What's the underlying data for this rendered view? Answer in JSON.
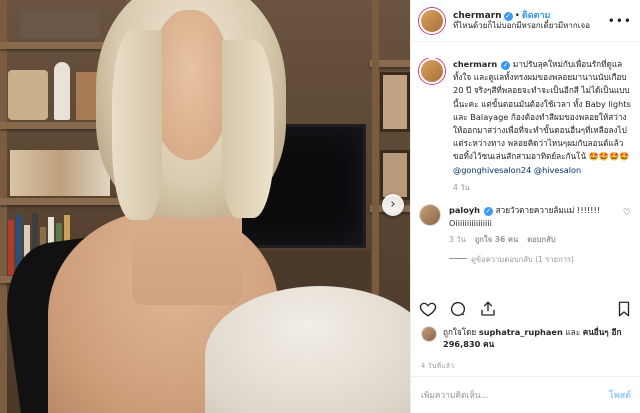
{
  "post": {
    "username": "chermarn",
    "follow_label": "ติดตาม",
    "header_subtitle": "ที่ไหนด้วยก็ไม่บอกมีหรอกเดี๋ยวมีหากเจอ",
    "caption": "มาปรับลุคใหม่กับเพื่อนรักที่ดูแลทั้งใจ และดูแลทั้งทรงผมของพลอยมานานนับเกือบ 20 ปี จริงๆสีที่พลอยจะทำจะเป็นอีกสี ไม่ได้เป็นแบบนี้นะคะ แต่ขั้นตอนมันต้องใช้เวลา ทั้ง Baby lights และ Balayage ก้องต้องทำสีผมของพลอยให้สว่างให้ออกมาสว่างเพื่อที่จะทำขั้นตอนอื่นๆที่เหลือลงไป แต่ระหว่างทาง พลอยคิดว่าไหนๆผมกับลอนต์แล้ว ขอทิ้งไว้ซนเล่นสักสามอาทิตย์ละกันโน้ 🤩🤩🤩🤩",
    "tags": "@gonghivesalon24 @hivesalon",
    "caption_time": "4 วัน"
  },
  "reply": {
    "username": "paloyh",
    "text": "สวยวัวตายควายล้มแม่ !!!!!!! Oiiiiiiiiiiiiiiii",
    "time": "3 วัน",
    "likes": "ถูกใจ 36 คน",
    "reply_label": "ตอบกลับ",
    "view_replies": "ดูข้อความตอบกลับ (1 รายการ)"
  },
  "likes": {
    "prefix": "ถูกใจโดย",
    "user": "suphatra_ruphaen",
    "and": "และ",
    "others": "คนอื่นๆ อีก 296,830 คน"
  },
  "date": "4 วันที่แล้ว",
  "comment_box": {
    "placeholder": "เพิ่มความคิดเห็น...",
    "post_label": "โพสต์"
  },
  "icons": [
    "more-icon",
    "heart-icon",
    "comment-icon",
    "share-icon",
    "bookmark-icon",
    "verified-icon",
    "next-arrow-icon"
  ],
  "colors": {
    "link": "#3897f0",
    "muted": "#999999",
    "text": "#262626"
  }
}
